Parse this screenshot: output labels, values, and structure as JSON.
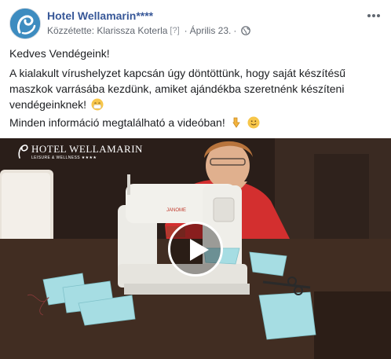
{
  "post": {
    "page_name": "Hotel Wellamarin",
    "page_stars": "****",
    "published_by": "Közzétette: Klarissza Koterla",
    "help_marker": "[?]",
    "separator": "·",
    "date": "Április 23.",
    "privacy_icon": "globe-icon",
    "menu_icon": "more-dots-icon",
    "greeting": "Kedves Vendégeink!",
    "body": "A kialakult vírushelyzet kapcsán úgy döntöttünk, hogy saját készítésű maszkok varrásába kezdünk, amiket ajándékba szeretnénk készíteni vendégeinknek!",
    "closing": "Minden információ megtalálható a videóban!"
  },
  "video": {
    "logo_text": "HOTEL WELLAMARIN",
    "logo_subtitle": "LEISURE & WELLNESS ★★★★",
    "machine_brand": "JANOME",
    "play_icon": "play-icon"
  },
  "colors": {
    "link": "#385898",
    "meta": "#616770",
    "text": "#1c1e21"
  }
}
